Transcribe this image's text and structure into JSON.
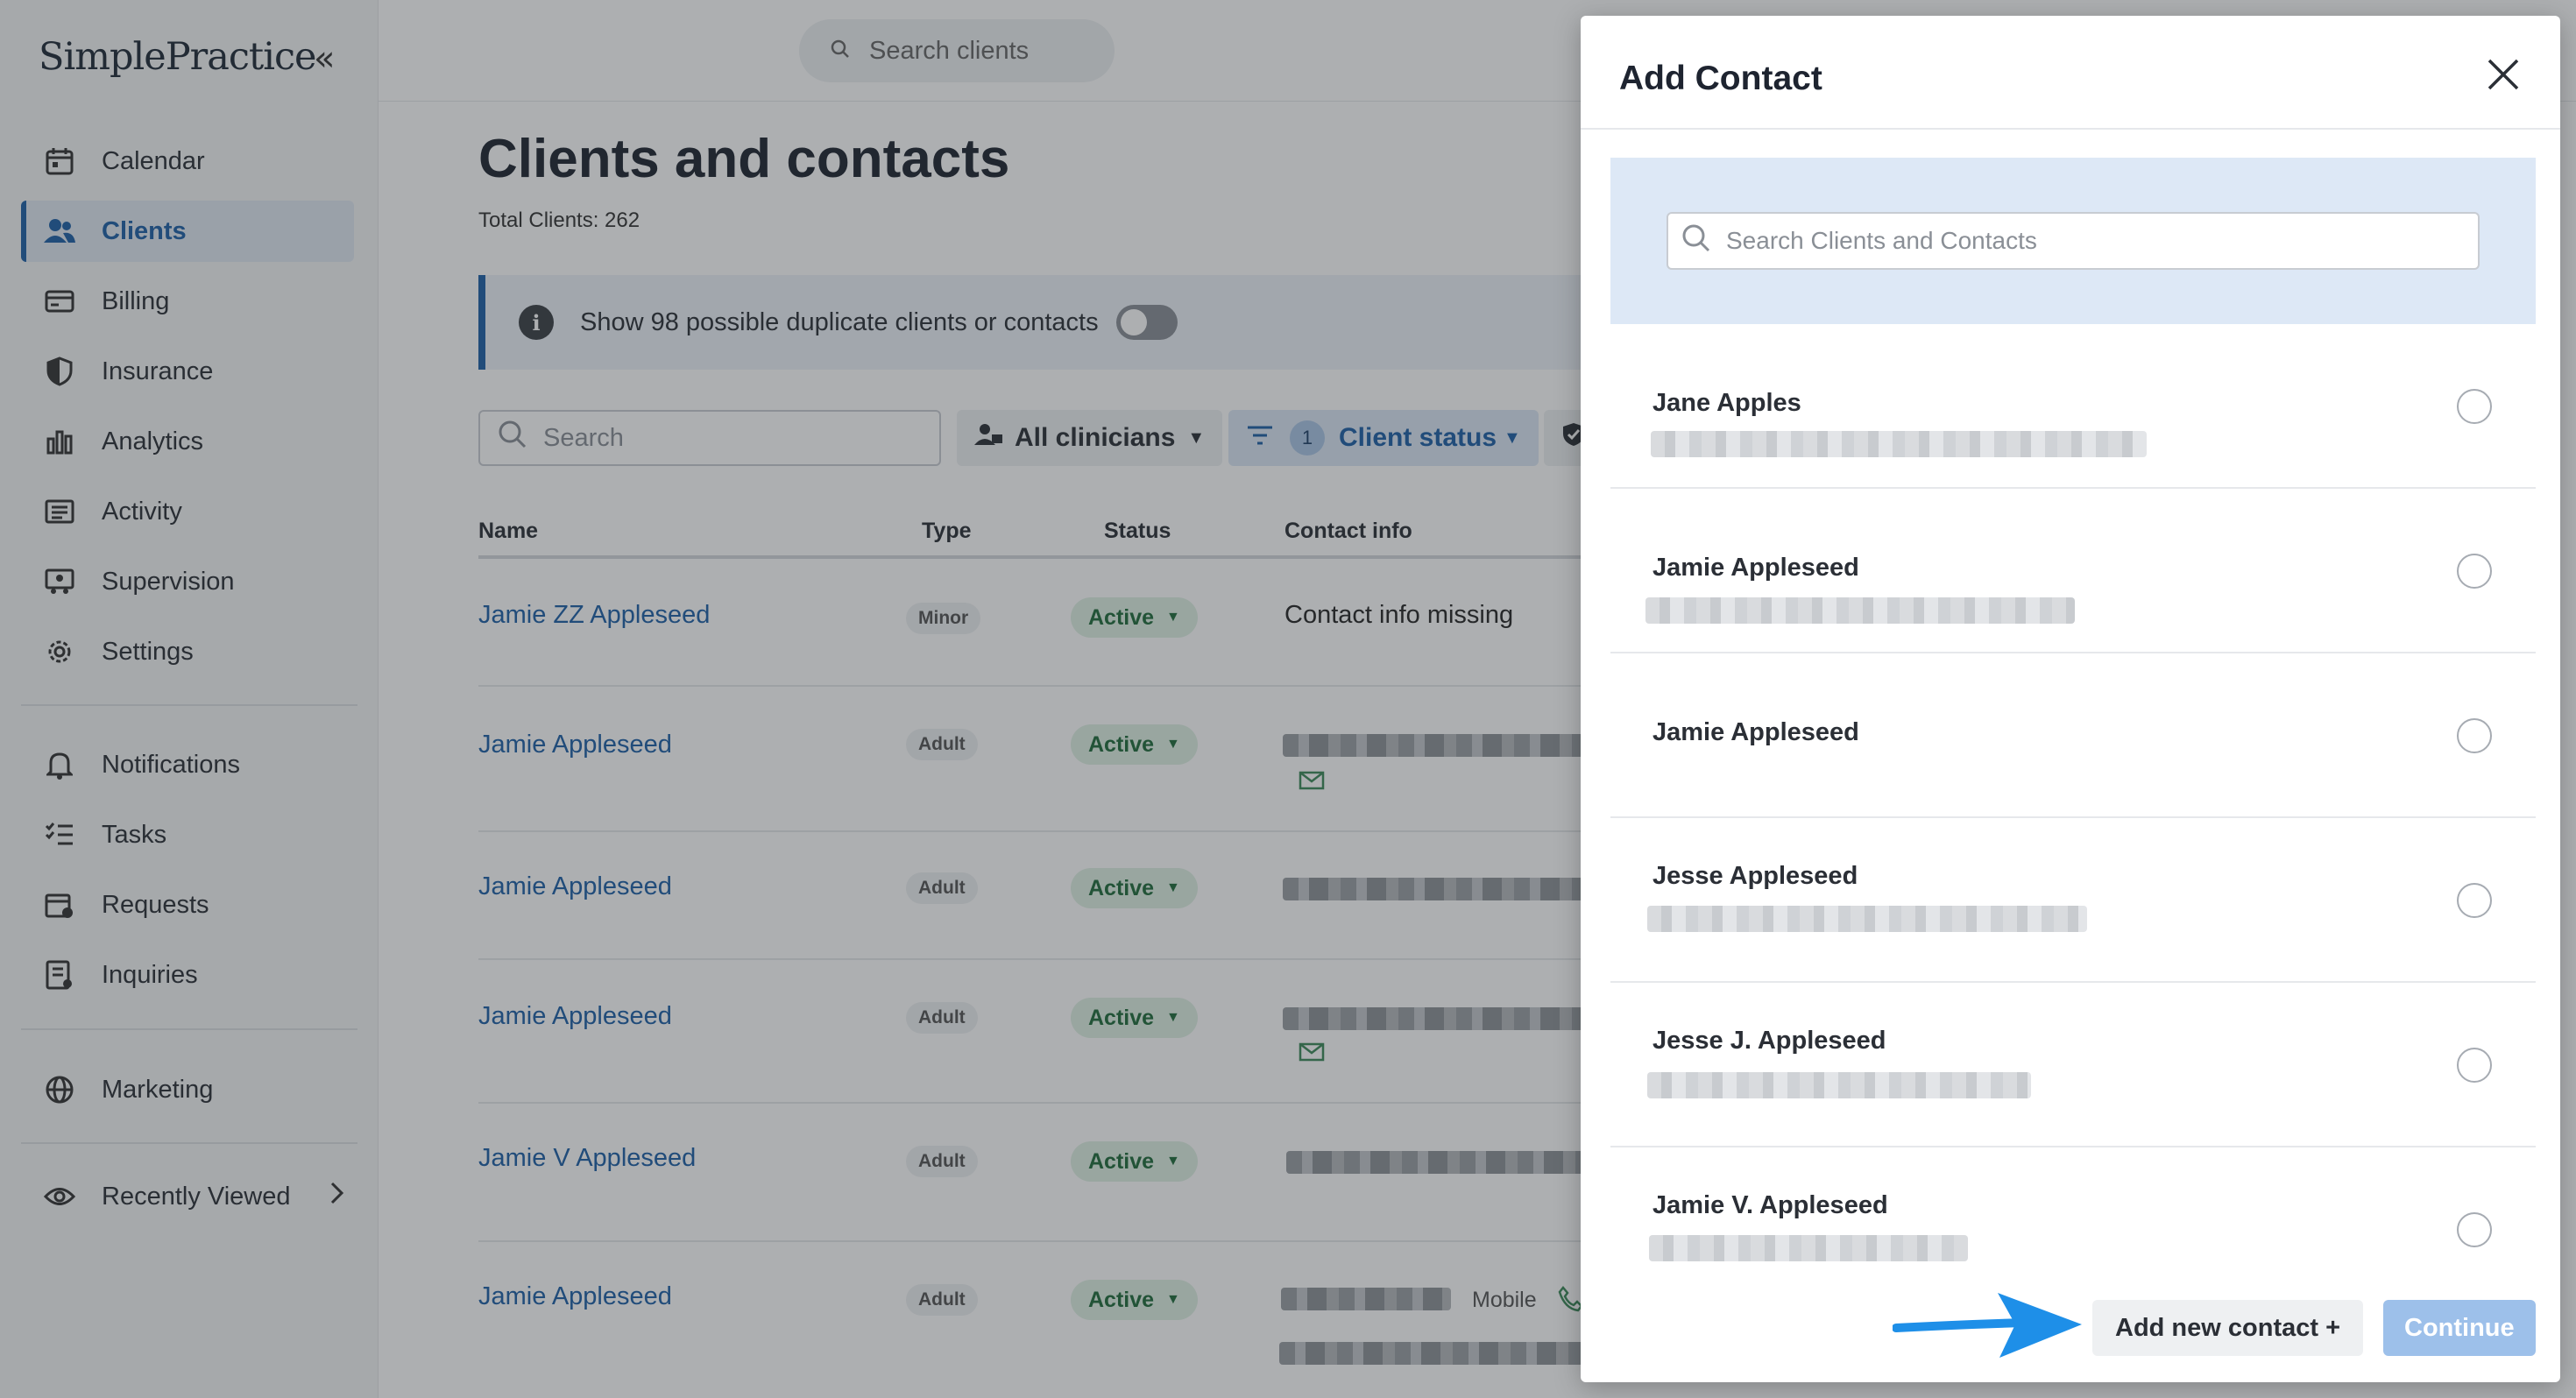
{
  "app": {
    "logo": "SimplePractice",
    "collapse_glyph": "«"
  },
  "sidebar": {
    "items": [
      {
        "label": "Calendar",
        "icon": "calendar-icon",
        "active": false
      },
      {
        "label": "Clients",
        "icon": "clients-icon",
        "active": true
      },
      {
        "label": "Billing",
        "icon": "billing-icon",
        "active": false
      },
      {
        "label": "Insurance",
        "icon": "shield-icon",
        "active": false
      },
      {
        "label": "Analytics",
        "icon": "analytics-icon",
        "active": false
      },
      {
        "label": "Activity",
        "icon": "activity-icon",
        "active": false
      },
      {
        "label": "Supervision",
        "icon": "supervision-icon",
        "active": false
      },
      {
        "label": "Settings",
        "icon": "gear-icon",
        "active": false
      },
      {
        "label": "Notifications",
        "icon": "bell-icon",
        "active": false
      },
      {
        "label": "Tasks",
        "icon": "tasks-icon",
        "active": false
      },
      {
        "label": "Requests",
        "icon": "requests-icon",
        "active": false
      },
      {
        "label": "Inquiries",
        "icon": "inquiries-icon",
        "active": false
      },
      {
        "label": "Marketing",
        "icon": "globe-icon",
        "active": false
      },
      {
        "label": "Recently Viewed",
        "icon": "eye-icon",
        "active": false
      }
    ]
  },
  "topbar": {
    "search_placeholder": "Search clients"
  },
  "page": {
    "title": "Clients and contacts",
    "total": "Total Clients: 262",
    "banner": "Show 98 possible duplicate clients or contacts",
    "search_placeholder": "Search",
    "filter_clinicians": "All clinicians",
    "filter_status_count": "1",
    "filter_status": "Client status"
  },
  "table": {
    "headers": [
      "Name",
      "Type",
      "Status",
      "Contact info"
    ],
    "rows": [
      {
        "name": "Jamie ZZ Appleseed",
        "type": "Minor",
        "status": "Active",
        "contact": "Contact info missing"
      },
      {
        "name": "Jamie Appleseed",
        "type": "Adult",
        "status": "Active",
        "contact": ""
      },
      {
        "name": "Jamie Appleseed",
        "type": "Adult",
        "status": "Active",
        "contact": ""
      },
      {
        "name": "Jamie Appleseed",
        "type": "Adult",
        "status": "Active",
        "contact": ""
      },
      {
        "name": "Jamie V Appleseed",
        "type": "Adult",
        "status": "Active",
        "contact": ""
      },
      {
        "name": "Jamie Appleseed",
        "type": "Adult",
        "status": "Active",
        "contact": "",
        "phone_label": "Mobile"
      }
    ]
  },
  "modal": {
    "title": "Add Contact",
    "search_placeholder": "Search Clients and Contacts",
    "contacts": [
      {
        "name": "Jane Apples"
      },
      {
        "name": "Jamie Appleseed"
      },
      {
        "name": "Jamie Appleseed"
      },
      {
        "name": "Jesse Appleseed"
      },
      {
        "name": "Jesse J. Appleseed"
      },
      {
        "name": "Jamie V. Appleseed"
      }
    ],
    "add_new": "Add new contact +",
    "continue": "Continue"
  },
  "colors": {
    "accent": "#1d5fa7",
    "arrow": "#1e8fe8",
    "status_bg": "#dff1e4",
    "continue_disabled": "#9dc0ea"
  }
}
